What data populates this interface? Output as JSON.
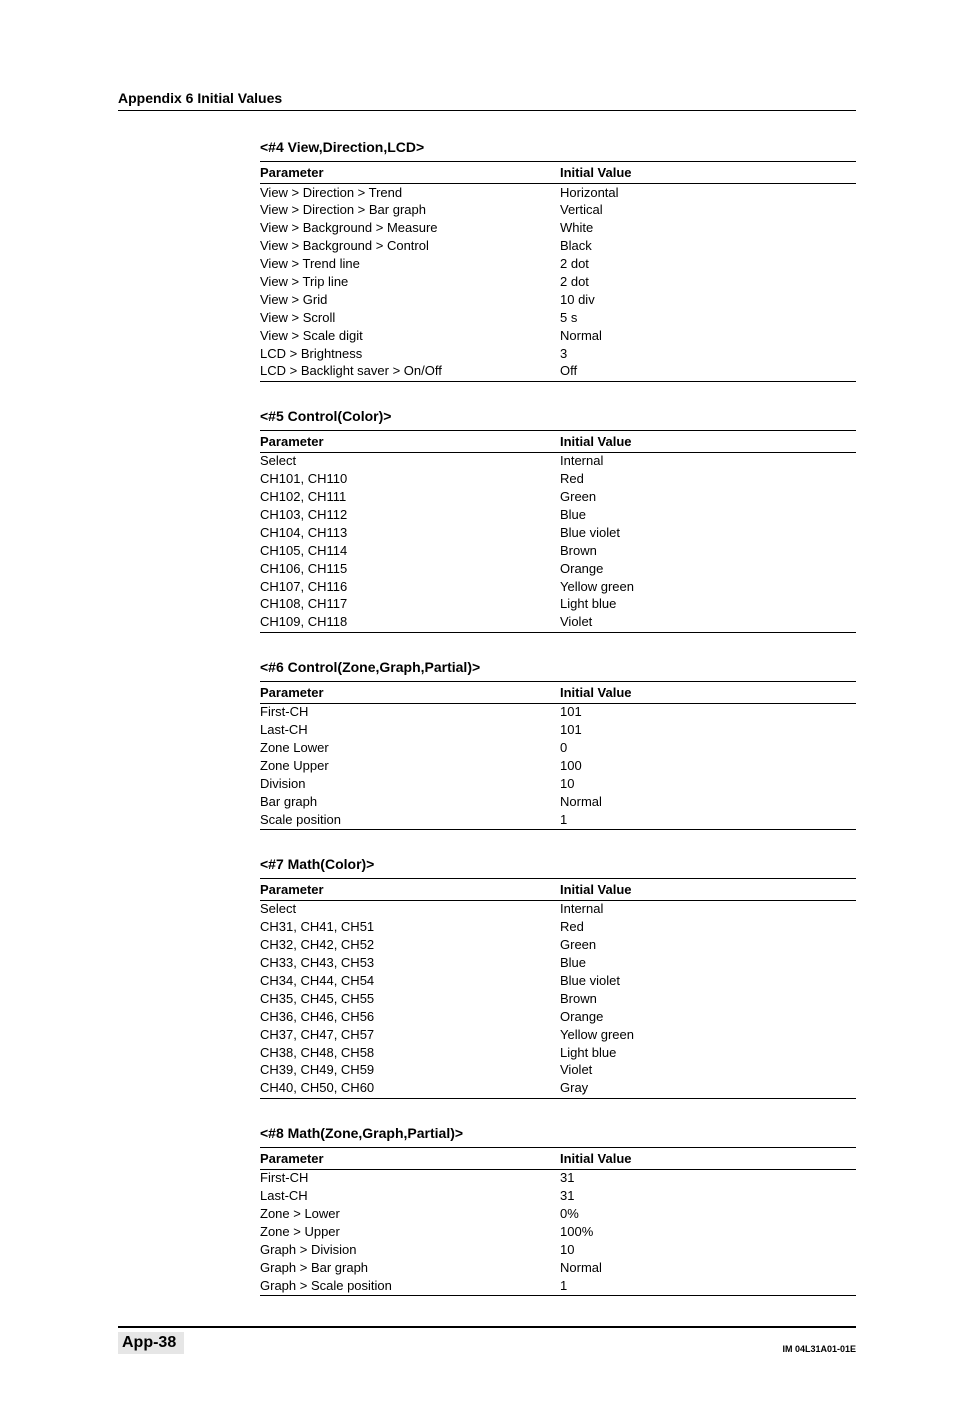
{
  "running_head": "Appendix 6  Initial Values",
  "column_headers": {
    "param": "Parameter",
    "val": "Initial Value"
  },
  "sections": [
    {
      "title": "<#4 View,Direction,LCD>",
      "rows": [
        {
          "param": "View > Direction > Trend",
          "val": "Horizontal"
        },
        {
          "param": "View > Direction > Bar graph",
          "val": "Vertical"
        },
        {
          "param": "View > Background > Measure",
          "val": "White"
        },
        {
          "param": "View > Background > Control",
          "val": "Black"
        },
        {
          "param": "View > Trend line",
          "val": "2 dot"
        },
        {
          "param": "View > Trip line",
          "val": "2 dot"
        },
        {
          "param": "View > Grid",
          "val": "10 div"
        },
        {
          "param": "View > Scroll",
          "val": "5 s"
        },
        {
          "param": "View > Scale digit",
          "val": "Normal"
        },
        {
          "param": "LCD > Brightness",
          "val": "3"
        },
        {
          "param": "LCD > Backlight saver > On/Off",
          "val": "Off"
        }
      ]
    },
    {
      "title": "<#5 Control(Color)>",
      "rows": [
        {
          "param": "Select",
          "val": "Internal"
        },
        {
          "param": "CH101, CH110",
          "val": "Red"
        },
        {
          "param": "CH102, CH111",
          "val": "Green"
        },
        {
          "param": "CH103, CH112",
          "val": "Blue"
        },
        {
          "param": "CH104, CH113",
          "val": "Blue violet"
        },
        {
          "param": "CH105, CH114",
          "val": "Brown"
        },
        {
          "param": "CH106, CH115",
          "val": "Orange"
        },
        {
          "param": "CH107, CH116",
          "val": "Yellow green"
        },
        {
          "param": "CH108, CH117",
          "val": "Light blue"
        },
        {
          "param": "CH109, CH118",
          "val": "Violet"
        }
      ]
    },
    {
      "title": "<#6 Control(Zone,Graph,Partial)>",
      "rows": [
        {
          "param": "First-CH",
          "val": "101"
        },
        {
          "param": "Last-CH",
          "val": "101"
        },
        {
          "param": "Zone Lower",
          "val": "0"
        },
        {
          "param": "Zone Upper",
          "val": "100"
        },
        {
          "param": "Division",
          "val": "10"
        },
        {
          "param": "Bar graph",
          "val": "Normal"
        },
        {
          "param": "Scale position",
          "val": "1"
        }
      ]
    },
    {
      "title": "<#7 Math(Color)>",
      "rows": [
        {
          "param": "Select",
          "val": "Internal"
        },
        {
          "param": "CH31, CH41, CH51",
          "val": "Red"
        },
        {
          "param": "CH32, CH42, CH52",
          "val": "Green"
        },
        {
          "param": "CH33, CH43, CH53",
          "val": "Blue"
        },
        {
          "param": "CH34, CH44, CH54",
          "val": "Blue violet"
        },
        {
          "param": "CH35, CH45, CH55",
          "val": "Brown"
        },
        {
          "param": "CH36, CH46, CH56",
          "val": "Orange"
        },
        {
          "param": "CH37, CH47, CH57",
          "val": "Yellow green"
        },
        {
          "param": "CH38, CH48, CH58",
          "val": "Light blue"
        },
        {
          "param": "CH39, CH49, CH59",
          "val": "Violet"
        },
        {
          "param": "CH40, CH50, CH60",
          "val": "Gray"
        }
      ]
    },
    {
      "title": "<#8 Math(Zone,Graph,Partial)>",
      "rows": [
        {
          "param": "First-CH",
          "val": "31"
        },
        {
          "param": "Last-CH",
          "val": "31"
        },
        {
          "param": "Zone > Lower",
          "val": "0%"
        },
        {
          "param": "Zone > Upper",
          "val": "100%"
        },
        {
          "param": "Graph > Division",
          "val": "10"
        },
        {
          "param": "Graph > Bar graph",
          "val": "Normal"
        },
        {
          "param": "Graph > Scale position",
          "val": "1"
        }
      ]
    }
  ],
  "footer": {
    "left": "App-38",
    "right": "IM 04L31A01-01E"
  }
}
